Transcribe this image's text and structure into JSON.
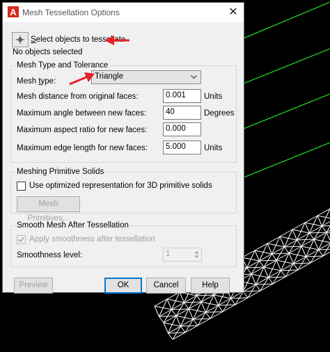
{
  "dialog": {
    "title": "Mesh Tessellation Options",
    "close_glyph": "✕",
    "app_icon_letter": "A",
    "select_objects_label": "Select objects to tessellate",
    "status_text": "No objects selected"
  },
  "mesh_type_group": {
    "title": "Mesh Type and Tolerance",
    "mesh_type_label": "Mesh type:",
    "mesh_type_value": "Triangle",
    "rows": [
      {
        "label": "Mesh distance from original faces:",
        "value": "0.001",
        "unit": "Units"
      },
      {
        "label": "Maximum angle between new faces:",
        "value": "40",
        "unit": "Degrees"
      },
      {
        "label": "Maximum aspect ratio for new faces:",
        "value": "0.000",
        "unit": ""
      },
      {
        "label": "Maximum edge length for new faces:",
        "value": "5.000",
        "unit": "Units"
      }
    ]
  },
  "primitive_group": {
    "title": "Meshing Primitive Solids",
    "checkbox_label": "Use optimized representation for 3D primitive solids",
    "checked": false,
    "button_label": "Mesh Primitives..."
  },
  "smooth_group": {
    "title": "Smooth Mesh After Tessellation",
    "checkbox_label": "Apply smoothness after tessellation",
    "checked": true,
    "level_label": "Smoothness level:",
    "level_value": "1"
  },
  "buttons": {
    "preview": "Preview",
    "ok": "OK",
    "cancel": "Cancel",
    "help": "Help"
  },
  "colors": {
    "annotation_arrow": "#e8202a",
    "background_lines": "#22ee22",
    "mesh_wireframe": "#ffffff",
    "canvas": "#000000"
  },
  "icons": [
    "autocad-logo-icon",
    "close-icon",
    "pick-objects-icon",
    "dropdown-arrow-icon",
    "spinner-arrows-icon",
    "red-arrow-icon"
  ]
}
